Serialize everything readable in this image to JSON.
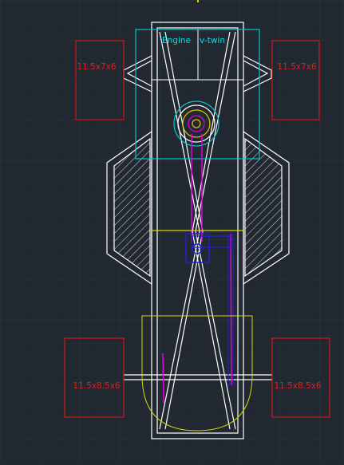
{
  "drawing": {
    "engine_label": "Engine",
    "engine_type_label": "v-twin",
    "front_tire_left_label": "11.5x7x6",
    "front_tire_right_label": "11.5x7x6",
    "rear_tire_left_label": "11.5x8.5x6",
    "rear_tire_right_label": "11.5x8.5x6"
  },
  "colors": {
    "background": "#212830",
    "grid_minor": "#262e37",
    "grid_major": "#2c3540",
    "frame": "#ffffff",
    "engine_outline": "#00c8c8",
    "engine_text": "#00e0e0",
    "tire": "#d01818",
    "tire_text": "#e02020",
    "yellow": "#d8d800",
    "chain": "#e000e0",
    "pulley": "#e8c000",
    "blue": "#2020d0"
  }
}
